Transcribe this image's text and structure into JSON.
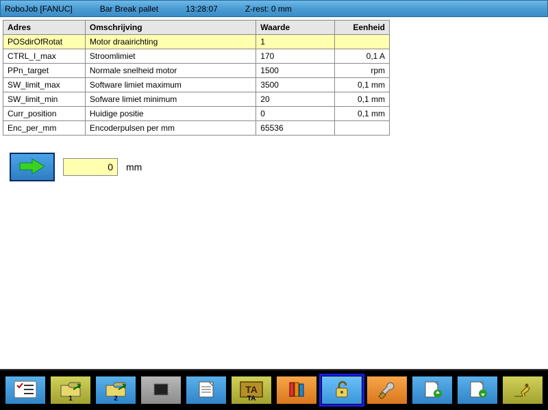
{
  "status": {
    "app": "RoboJob [FANUC]",
    "job": "Bar Break pallet",
    "time": "13:28:07",
    "zrest": "Z-rest: 0 mm"
  },
  "table": {
    "headers": {
      "adres": "Adres",
      "omschrijving": "Omschrijving",
      "waarde": "Waarde",
      "eenheid": "Eenheid"
    },
    "rows": [
      {
        "adres": "POSdirOfRotat",
        "omschrijving": "Motor draairichting",
        "waarde": "1",
        "eenheid": "",
        "sel": true
      },
      {
        "adres": "CTRL_I_max",
        "omschrijving": "Stroomlimiet",
        "waarde": "170",
        "eenheid": "0,1 A",
        "sel": false
      },
      {
        "adres": "PPn_target",
        "omschrijving": "Normale snelheid motor",
        "waarde": "1500",
        "eenheid": "rpm",
        "sel": false
      },
      {
        "adres": "SW_limit_max",
        "omschrijving": "Software limiet maximum",
        "waarde": "3500",
        "eenheid": "0,1 mm",
        "sel": false
      },
      {
        "adres": "SW_limit_min",
        "omschrijving": "Sofware limiet minimum",
        "waarde": "20",
        "eenheid": "0,1 mm",
        "sel": false
      },
      {
        "adres": "Curr_position",
        "omschrijving": "Huidige positie",
        "waarde": "0",
        "eenheid": "0,1 mm",
        "sel": false
      },
      {
        "adres": "Enc_per_mm",
        "omschrijving": "Encoderpulsen per mm",
        "waarde": "65536",
        "eenheid": "",
        "sel": false
      }
    ]
  },
  "action": {
    "value": "0",
    "unit": "mm"
  },
  "toolbar": {
    "items": [
      {
        "name": "checklist",
        "style": "blue",
        "sub": "",
        "active": false
      },
      {
        "name": "folder-1",
        "style": "olive",
        "sub": "1",
        "active": false
      },
      {
        "name": "folder-2",
        "style": "blue",
        "sub": "2",
        "active": false
      },
      {
        "name": "chip",
        "style": "gray",
        "sub": "",
        "active": false
      },
      {
        "name": "document",
        "style": "blue",
        "sub": "",
        "active": false
      },
      {
        "name": "ta",
        "style": "olive",
        "sub": "TA",
        "active": false
      },
      {
        "name": "books",
        "style": "orange",
        "sub": "",
        "active": false
      },
      {
        "name": "unlock",
        "style": "blue",
        "sub": "",
        "active": true
      },
      {
        "name": "wrench",
        "style": "orange",
        "sub": "",
        "active": false
      },
      {
        "name": "page-up",
        "style": "blue",
        "sub": "",
        "active": false
      },
      {
        "name": "page-down",
        "style": "blue",
        "sub": "",
        "active": false
      },
      {
        "name": "robot-arm",
        "style": "olive",
        "sub": "",
        "active": false
      }
    ]
  }
}
